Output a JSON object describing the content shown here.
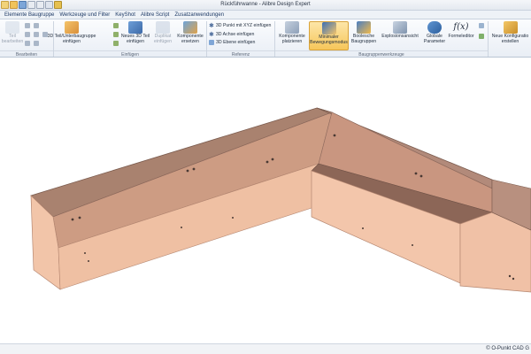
{
  "window": {
    "title": "Rückführwanne - Alibre Design Expert"
  },
  "quick_access": [
    "new-icon",
    "open-icon",
    "save-icon",
    "undo-icon",
    "redo-icon",
    "print-icon",
    "measure-icon"
  ],
  "menu": [
    "Elemente Baugruppe",
    "Werkzeuge und Filter",
    "KeyShot",
    "Alibre Script",
    "Zusatzanwendungen"
  ],
  "ribbon": {
    "groups": {
      "bearbeiten": "Bearbeiten",
      "einfuegen": "Einfügen",
      "referenz": "Referenz",
      "baugruppenwerkzeuge": "Baugruppenwerkzeuge"
    },
    "tools": {
      "teil": "Teil",
      "bearbeiten": "bearbeiten",
      "teil_unterbaugruppe": "3D Teil/Unterbaugruppe",
      "einfuegen": "einfügen",
      "neues_3d_teil": "Neues 3D Teil",
      "neues_3d_teil_sub": "einfügen",
      "duplikat": "Duplikat",
      "duplikat_sub": "einfügen",
      "komponente_ersetzen": "Komponente",
      "komponente_ersetzen_sub": "ersetzen",
      "punkt_xyz": "3D Punkt mit XYZ einfügen",
      "achse": "3D Achse einfügen",
      "ebene": "3D Ebene einfügen",
      "komponente_platzieren": "Komponente",
      "komponente_platzieren_sub": "platzieren",
      "minimaler": "Minimaler",
      "minimaler_sub": "Bewegungsmodus",
      "boolesche": "Boolesche",
      "boolesche_sub": "Baugruppen",
      "explosion": "Explosionsansicht",
      "globale": "Globale",
      "globale_sub": "Parameter",
      "formeleditor": "Formeleditor",
      "formeleditor_glyph": "f(x)",
      "neue_konfig": "Neue Konfiguratio",
      "neue_konfig_sub": "erstellen"
    }
  },
  "colors": {
    "part_top": "#b88f7f",
    "part_side": "#f0c2a8",
    "part_dark": "#8f6b5e",
    "accent_active": "#f6c65a",
    "ribbon_bg": "#eef2f7"
  },
  "status": {
    "copyright": "© O-Punkt CAD G"
  }
}
